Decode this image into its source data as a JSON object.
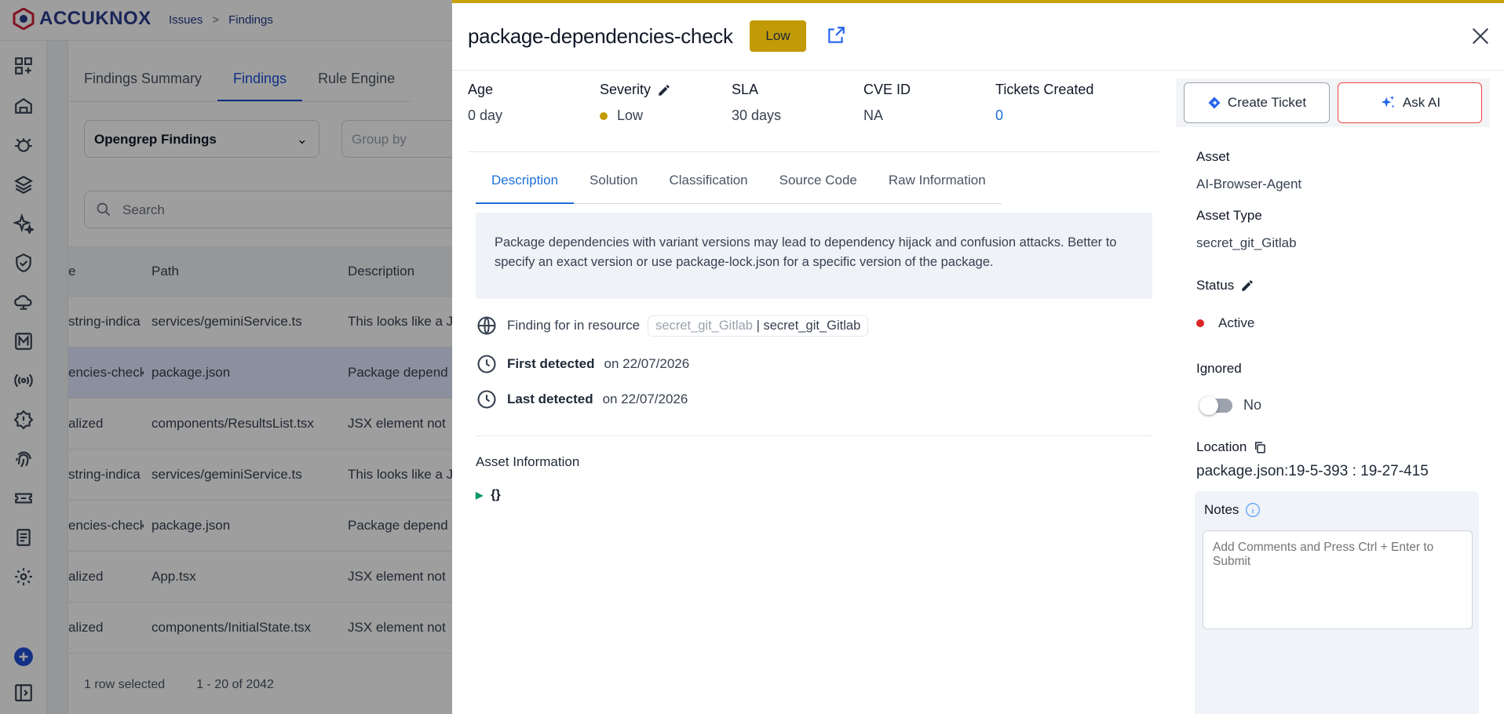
{
  "app": {
    "brand": "ACCUKNOX",
    "breadcrumb": [
      "Issues",
      "Findings"
    ]
  },
  "background": {
    "tabs": [
      "Findings Summary",
      "Findings",
      "Rule Engine"
    ],
    "active_tab": "Findings",
    "select_value": "Opengrep Findings",
    "group_by_placeholder": "Group by",
    "search_placeholder": "Search",
    "columns": [
      "e",
      "Path",
      "Description"
    ],
    "rows": [
      {
        "name": "string-indica",
        "path": "services/geminiService.ts",
        "desc": "This looks like a J"
      },
      {
        "name": "encies-check",
        "path": "package.json",
        "desc": "Package depend"
      },
      {
        "name": "alized",
        "path": "components/ResultsList.tsx",
        "desc": "JSX element not"
      },
      {
        "name": "string-indica",
        "path": "services/geminiService.ts",
        "desc": "This looks like a J"
      },
      {
        "name": "encies-check",
        "path": "package.json",
        "desc": "Package depend"
      },
      {
        "name": "alized",
        "path": "App.tsx",
        "desc": "JSX element not"
      },
      {
        "name": "alized",
        "path": "components/InitialState.tsx",
        "desc": "JSX element not"
      }
    ],
    "selected_row_index": 1,
    "footer_selected": "1 row selected",
    "footer_range": "1 - 20 of 2042"
  },
  "drawer": {
    "title": "package-dependencies-check",
    "severity_chip": "Low",
    "meta": {
      "age_label": "Age",
      "age_value": "0 day",
      "severity_label": "Severity",
      "severity_value": "Low",
      "sla_label": "SLA",
      "sla_value": "30 days",
      "cve_label": "CVE ID",
      "cve_value": "NA",
      "tickets_label": "Tickets Created",
      "tickets_value": "0"
    },
    "tabs": [
      "Description",
      "Solution",
      "Classification",
      "Source Code",
      "Raw Information"
    ],
    "active_tab": "Description",
    "description": "Package dependencies with variant versions may lead to dependency hijack and confusion attacks. Better to specify an exact version or use package-lock.json for a specific version of the package.",
    "resource_label": "Finding for in resource",
    "resource_type": "secret_git_Gitlab",
    "resource_sep": "|",
    "resource_name": "secret_git_Gitlab",
    "first_detected_label": "First detected",
    "first_detected_value": "on 22/07/2026",
    "last_detected_label": "Last detected",
    "last_detected_value": "on 22/07/2026",
    "asset_info_title": "Asset Information",
    "asset_info_tree": "{}"
  },
  "right_panel": {
    "create_ticket_label": "Create Ticket",
    "ask_ai_label": "Ask AI",
    "asset_label": "Asset",
    "asset_value": "AI-Browser-Agent",
    "asset_type_label": "Asset Type",
    "asset_type_value": "secret_git_Gitlab",
    "status_label": "Status",
    "status_value": "Active",
    "ignored_label": "Ignored",
    "ignored_value": "No",
    "location_label": "Location",
    "location_value": "package.json:19-5-393 : 19-27-415",
    "notes_label": "Notes",
    "notes_placeholder": "Add Comments and Press Ctrl + Enter to Submit"
  },
  "colors": {
    "accent": "#1d6ed8",
    "severity_low": "#c29a05",
    "status_active": "#dc2626",
    "drawer_top_border": "#c9a20a"
  }
}
